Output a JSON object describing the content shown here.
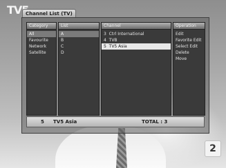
{
  "overlay": {
    "logo": "TV5",
    "badge": "2"
  },
  "window": {
    "title": "Channel List (TV)"
  },
  "panels": {
    "category": {
      "header": "Category",
      "items": [
        "All",
        "Favourite",
        "Network",
        "Satellite"
      ]
    },
    "list": {
      "header": "List",
      "items": [
        "A",
        "B",
        "C",
        "D"
      ]
    },
    "channel": {
      "header": "Channel",
      "items": [
        {
          "number": "3",
          "name": "Ctrl International"
        },
        {
          "number": "4",
          "name": "TVB"
        },
        {
          "number": "5",
          "name": "TV5 Asia"
        }
      ]
    },
    "operation": {
      "header": "Operation",
      "items": [
        "Edit",
        "Favorite Edit",
        "Select Edit",
        "Delete",
        "Move"
      ]
    }
  },
  "footer": {
    "number": "5",
    "name": "TV5 Asia",
    "total": "TOTAL : 3"
  }
}
